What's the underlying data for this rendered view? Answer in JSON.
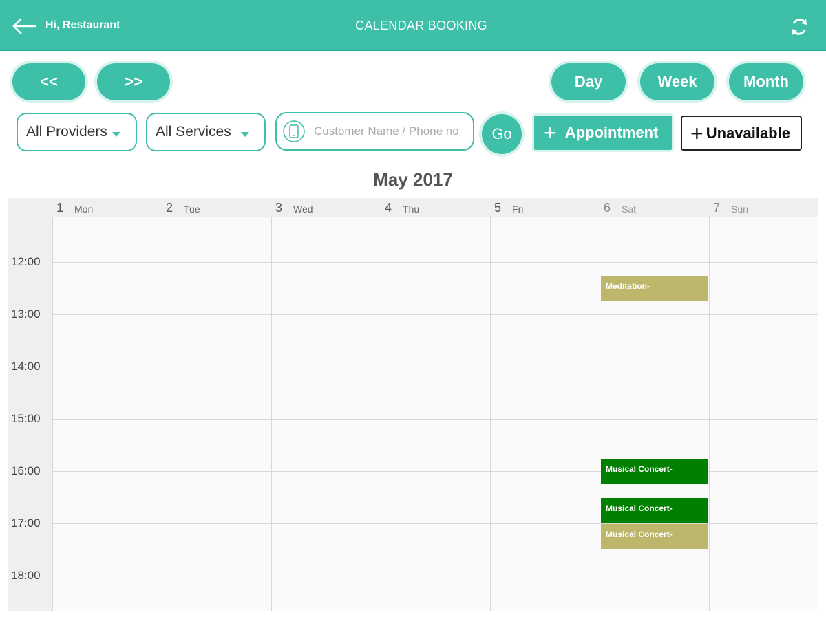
{
  "header": {
    "greeting": "Hi, Restaurant",
    "title": "CALENDAR BOOKING",
    "back_icon": "arrow-left-icon",
    "sync_icon": "sync-icon"
  },
  "nav": {
    "prev_label": "<<",
    "next_label": ">>"
  },
  "views": {
    "day_label": "Day",
    "week_label": "Week",
    "month_label": "Month"
  },
  "filters": {
    "providers_value": "All Providers",
    "services_value": "All Services",
    "search_placeholder": "Customer Name / Phone no",
    "go_label": "Go"
  },
  "actions": {
    "appointment_label": "Appointment",
    "unavailable_label": "Unavailable"
  },
  "calendar": {
    "month_title": "May 2017",
    "days": [
      {
        "num": "1",
        "name": "Mon"
      },
      {
        "num": "2",
        "name": "Tue"
      },
      {
        "num": "3",
        "name": "Wed"
      },
      {
        "num": "4",
        "name": "Thu"
      },
      {
        "num": "5",
        "name": "Fri"
      },
      {
        "num": "6",
        "name": "Sat"
      },
      {
        "num": "7",
        "name": "Sun"
      }
    ],
    "times": [
      "12:00",
      "13:00",
      "14:00",
      "15:00",
      "16:00",
      "17:00",
      "18:00"
    ],
    "events": [
      {
        "label": "Meditation-",
        "day": 5,
        "start": "12:15",
        "end": "12:45",
        "color": "#bdb76b"
      },
      {
        "label": "Musical Concert-",
        "day": 5,
        "start": "15:45",
        "end": "16:15",
        "color": "#008000"
      },
      {
        "label": "Musical Concert-",
        "day": 5,
        "start": "16:30",
        "end": "17:00",
        "color": "#008000"
      },
      {
        "label": "Musical Concert-",
        "day": 5,
        "start": "17:00",
        "end": "17:30",
        "color": "#bdb76b"
      }
    ]
  },
  "colors": {
    "accent": "#3dbfa8"
  }
}
